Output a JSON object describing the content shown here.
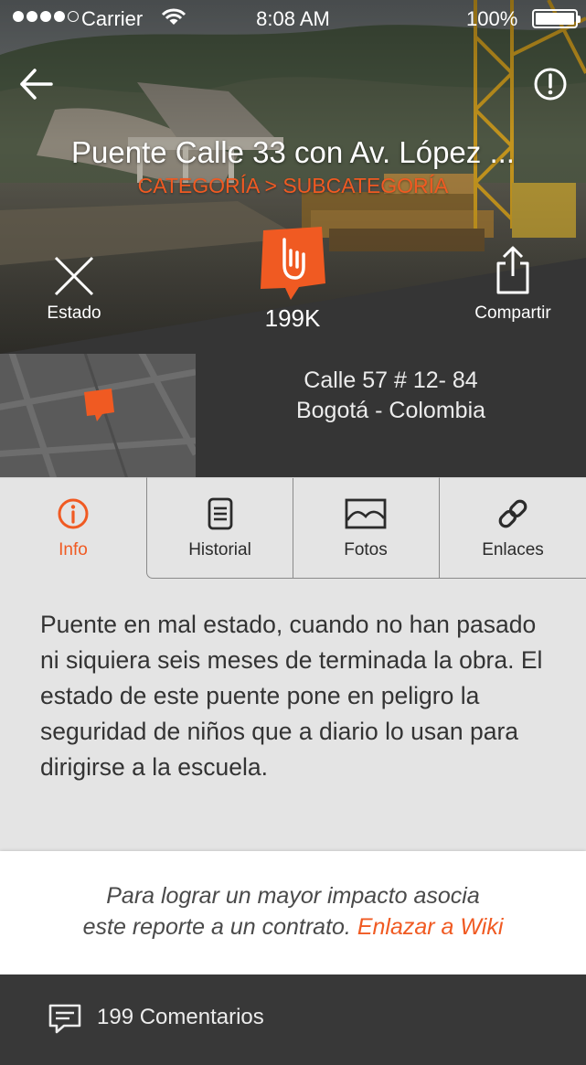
{
  "status_bar": {
    "carrier": "Carrier",
    "time": "8:08 AM",
    "battery": "100%"
  },
  "report": {
    "title": "Puente Calle 33 con Av. López ...",
    "category": "CATEGORÍA > SUBCATEGORÍA",
    "supports": "199K",
    "address_line1": "Calle 57 # 12- 84",
    "address_line2": "Bogotá - Colombia",
    "description": "Puente en mal estado, cuando no han pasado ni siquiera seis meses de terminada la obra. El estado de este puente pone en peligro la seguridad de niños que a diario lo usan para dirigirse a la escuela."
  },
  "actions": {
    "status_label": "Estado",
    "share_label": "Compartir"
  },
  "tabs": [
    {
      "label": "Info",
      "icon": "info-icon",
      "active": true
    },
    {
      "label": "Historial",
      "icon": "document-icon",
      "active": false
    },
    {
      "label": "Fotos",
      "icon": "image-icon",
      "active": false
    },
    {
      "label": "Enlaces",
      "icon": "link-icon",
      "active": false
    }
  ],
  "wiki": {
    "line1": "Para lograr un mayor impacto asocia",
    "line2": "este reporte a un contrato.",
    "link": "Enlazar a Wiki"
  },
  "comments": {
    "label": "199 Comentarios"
  },
  "colors": {
    "accent": "#f05a22",
    "dark_panel": "#353535",
    "footer": "#383838",
    "background": "#e4e4e4"
  }
}
